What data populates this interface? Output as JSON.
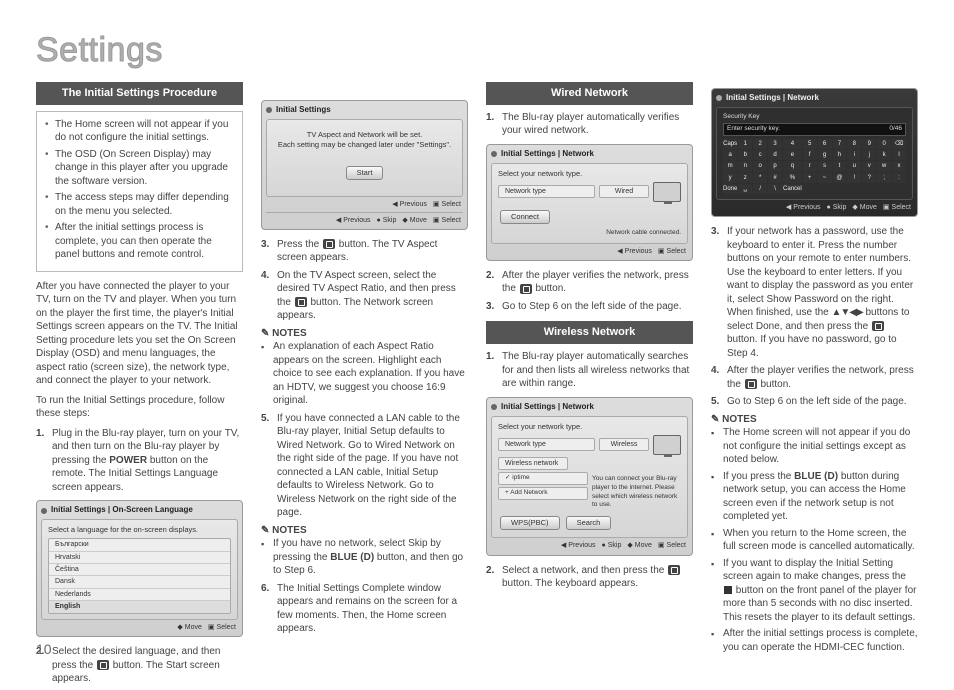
{
  "page_title": "Settings",
  "page_number": "10",
  "col1": {
    "header": "The Initial Settings Procedure",
    "box_bullets": [
      "The Home screen will not appear if you do not configure the initial settings.",
      "The OSD (On Screen Display) may change in this player after you upgrade the software version.",
      "The access steps may differ depending on the menu you selected.",
      "After the initial settings process is complete, you can then operate the panel buttons and remote control."
    ],
    "p1": "After you have connected the player to your TV, turn on the TV and player. When you turn on the player the first time, the player's Initial Settings screen appears on the TV. The Initial Setting procedure lets you set the On Screen Display (OSD) and menu languages, the aspect ratio (screen size), the network type, and connect the player to your network.",
    "p2": "To run the Initial Settings procedure, follow these steps:",
    "step1_a": "Plug in the Blu-ray player, turn on your TV, and then turn on the Blu-ray player by pressing the ",
    "step1_power": "POWER",
    "step1_b": " button on the remote. The Initial Settings Language screen appears.",
    "shot_lang_title": "Initial Settings | On-Screen Language",
    "shot_lang_prompt": "Select a language for the on-screen displays.",
    "shot_lang_items": [
      "Български",
      "Hrvatski",
      "Čeština",
      "Dansk",
      "Nederlands",
      "English"
    ],
    "shot_lang_footer_move": "Move",
    "shot_lang_footer_select": "Select",
    "step2_a": "Select the desired language, and then press the ",
    "step2_b": " button. The Start screen appears."
  },
  "col2": {
    "shot_start_title": "Initial Settings",
    "shot_start_line1": "TV Aspect and Network will be set.",
    "shot_start_line2": "Each setting may be changed later under \"Settings\".",
    "shot_start_btn": "Start",
    "shot_start_prev": "Previous",
    "shot_start_skip": "Skip",
    "shot_start_move": "Move",
    "shot_start_select": "Select",
    "step3_a": "Press the ",
    "step3_b": " button. The TV Aspect screen appears.",
    "step4_a": "On the TV Aspect screen, select the desired TV Aspect Ratio, and then press the ",
    "step4_b": " button. The Network screen appears.",
    "notes_label": "NOTES",
    "note_aspect": "An explanation of each Aspect Ratio appears on the screen. Highlight each choice to see each explanation. If you have an HDTV, we suggest you choose 16:9 original.",
    "step5": "If you have connected a LAN cable to the Blu-ray player, Initial Setup defaults to Wired Network. Go to Wired Network on the right side of the page. If you have not connected a LAN cable, Initial Setup defaults to Wireless Network. Go to Wireless Network on the right side of the page.",
    "note_skip_a": "If you have no network, select Skip by pressing the ",
    "note_skip_blue": "BLUE (D)",
    "note_skip_b": " button, and then go to Step 6.",
    "step6": "The Initial Settings Complete window appears and remains on the screen for a few moments. Then, the Home screen appears."
  },
  "col3": {
    "header_wired": "Wired Network",
    "wired_step1": "The Blu-ray player automatically verifies your wired network.",
    "shot_wired_title": "Initial Settings | Network",
    "shot_wired_prompt": "Select your network type.",
    "shot_wired_type_label": "Network type",
    "shot_wired_type_value": "Wired",
    "shot_wired_connect": "Connect",
    "shot_wired_status": "Network cable connected.",
    "shot_footer_prev": "Previous",
    "shot_footer_select": "Select",
    "wired_step2_a": "After the player verifies the network, press the ",
    "wired_step2_b": " button.",
    "wired_step3": "Go to Step 6 on the left side of the page.",
    "header_wireless": "Wireless Network",
    "wireless_step1": "The Blu-ray player automatically searches for and then lists all wireless networks that are within range.",
    "shot_wl_title": "Initial Settings | Network",
    "shot_wl_prompt": "Select your network type.",
    "shot_wl_type_label": "Network type",
    "shot_wl_type_value": "Wireless",
    "shot_wl_net_label": "Wireless network",
    "shot_wl_net_item": "iptime",
    "shot_wl_add": "Add Network",
    "shot_wl_hint": "You can connect your Blu-ray player to the internet. Please select which wireless network to use.",
    "shot_wl_btn_wps": "WPS(PBC)",
    "shot_wl_btn_search": "Search",
    "shot_wl_prev": "Previous",
    "shot_wl_skip": "Skip",
    "shot_wl_move": "Move",
    "shot_wl_select": "Select",
    "wireless_step2_a": "Select a network, and then press the ",
    "wireless_step2_b": " button. The keyboard appears."
  },
  "col4": {
    "shot_kb_title": "Initial Settings | Network",
    "shot_kb_sec": "Security Key",
    "shot_kb_prompt": "Enter security key.",
    "shot_kb_count": "0/46",
    "shot_kb_keys": [
      "Caps",
      "1",
      "2",
      "3",
      "4",
      "5",
      "6",
      "7",
      "8",
      "9",
      "0",
      "⌫",
      "a",
      "b",
      "c",
      "d",
      "e",
      "f",
      "g",
      "h",
      "i",
      "j",
      "k",
      "l",
      "m",
      "n",
      "o",
      "p",
      "q",
      "r",
      "s",
      "t",
      "u",
      "v",
      "w",
      "x",
      "y",
      "z",
      "*",
      "#",
      "%",
      "+",
      "~",
      "@",
      "!",
      "?",
      ";",
      ":",
      "Done",
      "␣",
      "/",
      "\\",
      "Cancel"
    ],
    "shot_kb_prev": "Previous",
    "shot_kb_skip": "Skip",
    "shot_kb_move": "Move",
    "shot_kb_select": "Select",
    "step3_a": "If your network has a password, use the keyboard to enter it. Press the number buttons on your remote to enter numbers. Use the keyboard to enter letters. If you want to display the password as you enter it, select Show Password on the right. When finished, use the ",
    "step3_arrows": "▲▼◀▶",
    "step3_b": " buttons to select Done, and then press the ",
    "step3_c": " button. If you have no password, go to Step 4.",
    "step4_a": "After the player verifies the network, press the ",
    "step4_b": " button.",
    "step5": "Go to Step 6 on the left side of the page.",
    "notes_label": "NOTES",
    "nb1": "The Home screen will not appear if you do not configure the initial settings except as noted below.",
    "nb2_a": "If you press the ",
    "nb2_blue": "BLUE (D)",
    "nb2_b": " button during network setup, you can access the Home screen even if the network setup is not completed yet.",
    "nb3": "When you return to the Home screen, the full screen mode is cancelled automatically.",
    "nb4_a": "If you want to display the Initial Setting screen again to make changes, press the ",
    "nb4_b": " button on the front panel of the player for more than 5 seconds with no disc inserted. This resets the player to its default settings.",
    "nb5": "After the initial settings process is complete, you can operate the HDMI-CEC function."
  }
}
